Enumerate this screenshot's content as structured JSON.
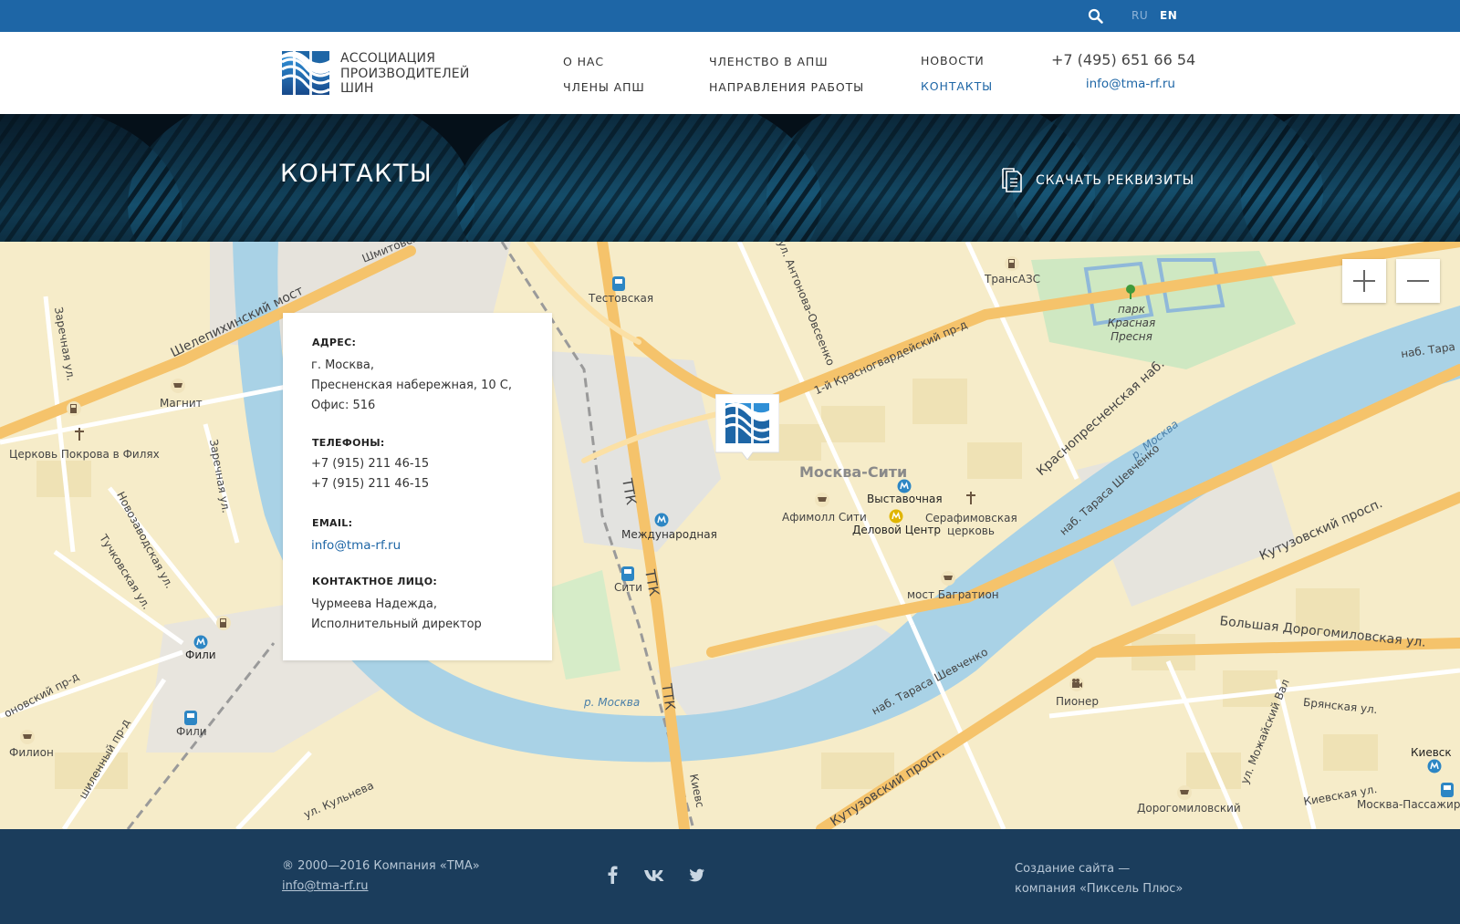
{
  "topbar": {
    "lang_ru": "RU",
    "lang_en": "EN",
    "search_icon": "search-icon"
  },
  "header": {
    "logo_line1": "Ассоциация",
    "logo_line2": "производителей",
    "logo_line3": "шин",
    "nav": {
      "about": "О нас",
      "membership": "Членство в АПШ",
      "news": "Новости",
      "members": "Члены АПШ",
      "directions": "Направления работы",
      "contacts": "Контакты"
    },
    "phone": "+7 (495) 651 66 54",
    "email": "info@tma-rf.ru"
  },
  "banner": {
    "title": "Контакты",
    "download_label": "Скачать реквизиты",
    "download_icon": "document-icon"
  },
  "contact_card": {
    "address_heading": "Адрес:",
    "address_line1": "г. Москва,",
    "address_line2": "Пресненская набережная, 10 С,",
    "address_line3": "Офис: 516",
    "phones_heading": "Телефоны:",
    "phone1": "+7 (915) 211 46-15",
    "phone2": "+7 (915) 211 46-15",
    "email_heading": "Email:",
    "email": "info@tma-rf.ru",
    "person_heading": "Контактное лицо:",
    "person_name": "Чурмеева Надежда,",
    "person_role": "Исполнительный директор"
  },
  "map": {
    "labels": {
      "testovskaya": "Тестовская",
      "shmitovsky": "Шмитовск",
      "shelepikhinsky": "Шелепихинский мост",
      "zarechnaya1": "Заречная ул.",
      "zarechnaya2": "Заречная ул.",
      "magnit": "Магнит",
      "church_fili": "Церковь Покрова в Филях",
      "novozavodskaya": "Новозаводская ул.",
      "tuchkovskaya": "Тучковская ул.",
      "ttk1": "ТТК",
      "ttk2": "ТТК",
      "ttk3": "ТТК",
      "mezhdunarodnaya": "Международная",
      "siti": "Сити",
      "antonova": "ул. Антонова-Овсеенко",
      "krasnogvardeysky": "1-й Красногвардейский пр-д",
      "transazs": "ТрансАЗС",
      "park": "парк Красная Пресня",
      "naberezhnaya_tara": "наб. Тара",
      "krasnopresnenskaya": "Краснопресненская наб.",
      "river1": "р. Москва",
      "river2": "р. Москва",
      "moscow_city": "Москва-Сити",
      "vystavochnaya": "Выставочная",
      "afimall": "Афимолл Сити",
      "delovoy": "Деловой Центр",
      "serafimovskaya": "Серафимовская церковь",
      "nab_shevchenko1": "наб. Тараса Шевченко",
      "nab_shevchenko2": "наб. Тараса Шевченко",
      "kutuzovsky1": "Кутузовский просп.",
      "kutuzovsky2": "Кутузовский просп.",
      "most_bagration": "мост Багратион",
      "bolshaya_dorogomilovskaya": "Большая Дорогомиловская ул.",
      "pioner": "Пионер",
      "bryanskaya": "Брянская ул.",
      "mozhaysky": "ул. Можайский Вал",
      "kievskaya1": "Киевск",
      "kievskaya2": "Киевская ул.",
      "moscow_passenger": "Москва-Пассажир",
      "dorogomilovsky": "Дорогомиловский",
      "fili1": "Фили",
      "fili2": "Фили",
      "filion": "Филион",
      "novsky_prd": "оновский пр-д",
      "shilenny": "шиленный пр-д",
      "kulneva": "ул. Кульнева",
      "kievs_road": "Киевс"
    }
  },
  "footer": {
    "copyright": "® 2000—2016  Компания «ТМА»",
    "email": "info@tma-rf.ru",
    "credit_line1": "Создание сайта —",
    "credit_line2": "компания «Пиксель Плюс»",
    "icons": {
      "facebook": "facebook-icon",
      "vk": "vk-icon",
      "twitter": "twitter-icon"
    }
  },
  "colors": {
    "brand_blue": "#1e66a6",
    "footer": "#1b3d5c",
    "map_land": "#f6ecc9",
    "map_water": "#a9d2e6",
    "map_road": "#f5c36b"
  }
}
